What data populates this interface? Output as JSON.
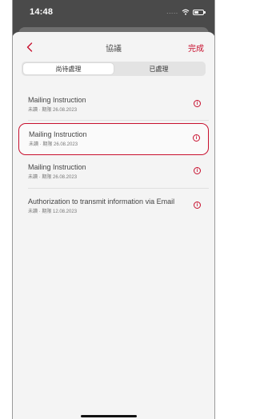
{
  "status": {
    "time": "14:48",
    "signal_dots": "....."
  },
  "nav": {
    "title": "協議",
    "done_label": "完成"
  },
  "segments": [
    {
      "label": "尚待處理",
      "active": true
    },
    {
      "label": "已處理",
      "active": false
    }
  ],
  "items": [
    {
      "title": "Mailing Instruction",
      "subtitle": "未讀 · 期限 26.08.2023",
      "highlighted": false
    },
    {
      "title": "Mailing Instruction",
      "subtitle": "未讀 · 期限 26.08.2023",
      "highlighted": true
    },
    {
      "title": "Mailing Instruction",
      "subtitle": "未讀 · 期限 26.08.2023",
      "highlighted": false
    },
    {
      "title": "Authorization to transmit information via Email",
      "subtitle": "未讀 · 期限 12.08.2023",
      "highlighted": false
    }
  ],
  "icons": {
    "back": "chevron-left-icon",
    "info": "info-icon",
    "wifi": "wifi-icon",
    "battery": "battery-icon"
  },
  "colors": {
    "accent": "#c8102e",
    "sheet_background": "#f4f4f4",
    "device_background": "#4a4a4a"
  },
  "info_glyph": "i"
}
